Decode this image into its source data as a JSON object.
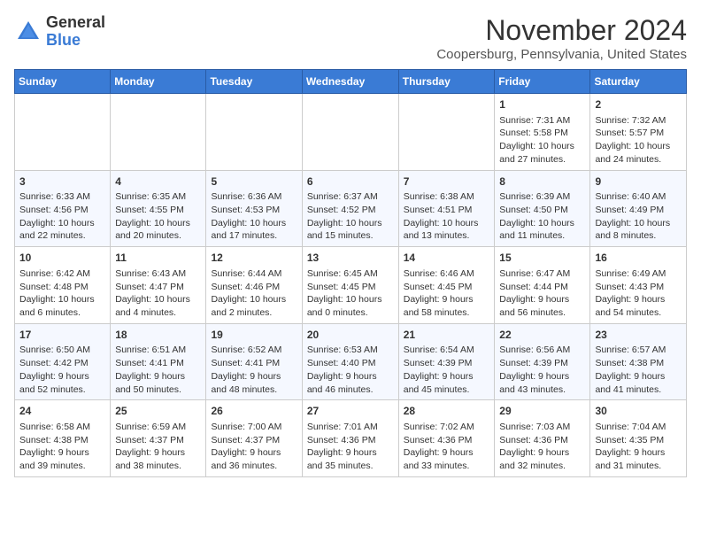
{
  "header": {
    "logo_general": "General",
    "logo_blue": "Blue",
    "month_title": "November 2024",
    "location": "Coopersburg, Pennsylvania, United States"
  },
  "days_of_week": [
    "Sunday",
    "Monday",
    "Tuesday",
    "Wednesday",
    "Thursday",
    "Friday",
    "Saturday"
  ],
  "weeks": [
    [
      {
        "day": "",
        "info": ""
      },
      {
        "day": "",
        "info": ""
      },
      {
        "day": "",
        "info": ""
      },
      {
        "day": "",
        "info": ""
      },
      {
        "day": "",
        "info": ""
      },
      {
        "day": "1",
        "info": "Sunrise: 7:31 AM\nSunset: 5:58 PM\nDaylight: 10 hours and 27 minutes."
      },
      {
        "day": "2",
        "info": "Sunrise: 7:32 AM\nSunset: 5:57 PM\nDaylight: 10 hours and 24 minutes."
      }
    ],
    [
      {
        "day": "3",
        "info": "Sunrise: 6:33 AM\nSunset: 4:56 PM\nDaylight: 10 hours and 22 minutes."
      },
      {
        "day": "4",
        "info": "Sunrise: 6:35 AM\nSunset: 4:55 PM\nDaylight: 10 hours and 20 minutes."
      },
      {
        "day": "5",
        "info": "Sunrise: 6:36 AM\nSunset: 4:53 PM\nDaylight: 10 hours and 17 minutes."
      },
      {
        "day": "6",
        "info": "Sunrise: 6:37 AM\nSunset: 4:52 PM\nDaylight: 10 hours and 15 minutes."
      },
      {
        "day": "7",
        "info": "Sunrise: 6:38 AM\nSunset: 4:51 PM\nDaylight: 10 hours and 13 minutes."
      },
      {
        "day": "8",
        "info": "Sunrise: 6:39 AM\nSunset: 4:50 PM\nDaylight: 10 hours and 11 minutes."
      },
      {
        "day": "9",
        "info": "Sunrise: 6:40 AM\nSunset: 4:49 PM\nDaylight: 10 hours and 8 minutes."
      }
    ],
    [
      {
        "day": "10",
        "info": "Sunrise: 6:42 AM\nSunset: 4:48 PM\nDaylight: 10 hours and 6 minutes."
      },
      {
        "day": "11",
        "info": "Sunrise: 6:43 AM\nSunset: 4:47 PM\nDaylight: 10 hours and 4 minutes."
      },
      {
        "day": "12",
        "info": "Sunrise: 6:44 AM\nSunset: 4:46 PM\nDaylight: 10 hours and 2 minutes."
      },
      {
        "day": "13",
        "info": "Sunrise: 6:45 AM\nSunset: 4:45 PM\nDaylight: 10 hours and 0 minutes."
      },
      {
        "day": "14",
        "info": "Sunrise: 6:46 AM\nSunset: 4:45 PM\nDaylight: 9 hours and 58 minutes."
      },
      {
        "day": "15",
        "info": "Sunrise: 6:47 AM\nSunset: 4:44 PM\nDaylight: 9 hours and 56 minutes."
      },
      {
        "day": "16",
        "info": "Sunrise: 6:49 AM\nSunset: 4:43 PM\nDaylight: 9 hours and 54 minutes."
      }
    ],
    [
      {
        "day": "17",
        "info": "Sunrise: 6:50 AM\nSunset: 4:42 PM\nDaylight: 9 hours and 52 minutes."
      },
      {
        "day": "18",
        "info": "Sunrise: 6:51 AM\nSunset: 4:41 PM\nDaylight: 9 hours and 50 minutes."
      },
      {
        "day": "19",
        "info": "Sunrise: 6:52 AM\nSunset: 4:41 PM\nDaylight: 9 hours and 48 minutes."
      },
      {
        "day": "20",
        "info": "Sunrise: 6:53 AM\nSunset: 4:40 PM\nDaylight: 9 hours and 46 minutes."
      },
      {
        "day": "21",
        "info": "Sunrise: 6:54 AM\nSunset: 4:39 PM\nDaylight: 9 hours and 45 minutes."
      },
      {
        "day": "22",
        "info": "Sunrise: 6:56 AM\nSunset: 4:39 PM\nDaylight: 9 hours and 43 minutes."
      },
      {
        "day": "23",
        "info": "Sunrise: 6:57 AM\nSunset: 4:38 PM\nDaylight: 9 hours and 41 minutes."
      }
    ],
    [
      {
        "day": "24",
        "info": "Sunrise: 6:58 AM\nSunset: 4:38 PM\nDaylight: 9 hours and 39 minutes."
      },
      {
        "day": "25",
        "info": "Sunrise: 6:59 AM\nSunset: 4:37 PM\nDaylight: 9 hours and 38 minutes."
      },
      {
        "day": "26",
        "info": "Sunrise: 7:00 AM\nSunset: 4:37 PM\nDaylight: 9 hours and 36 minutes."
      },
      {
        "day": "27",
        "info": "Sunrise: 7:01 AM\nSunset: 4:36 PM\nDaylight: 9 hours and 35 minutes."
      },
      {
        "day": "28",
        "info": "Sunrise: 7:02 AM\nSunset: 4:36 PM\nDaylight: 9 hours and 33 minutes."
      },
      {
        "day": "29",
        "info": "Sunrise: 7:03 AM\nSunset: 4:36 PM\nDaylight: 9 hours and 32 minutes."
      },
      {
        "day": "30",
        "info": "Sunrise: 7:04 AM\nSunset: 4:35 PM\nDaylight: 9 hours and 31 minutes."
      }
    ]
  ]
}
